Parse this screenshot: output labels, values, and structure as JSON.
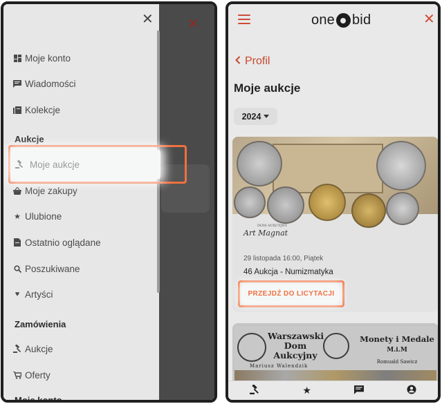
{
  "left_screen": {
    "drawer": {
      "items": [
        {
          "label": "Moje konto",
          "icon": "dashboard-icon"
        },
        {
          "label": "Wiadomości",
          "icon": "message-icon"
        },
        {
          "label": "Kolekcje",
          "icon": "collection-icon"
        }
      ],
      "section_aukcje": "Aukcje",
      "aukcje_items": [
        {
          "label": "Moje aukcje",
          "icon": "gavel-icon",
          "active": true
        },
        {
          "label": "Moje zakupy",
          "icon": "basket-icon"
        },
        {
          "label": "Ulubione",
          "icon": "star-icon"
        },
        {
          "label": "Ostatnio oglądane",
          "icon": "document-icon"
        },
        {
          "label": "Poszukiwane",
          "icon": "search-icon"
        },
        {
          "label": "Artyści",
          "icon": "heart-icon"
        }
      ],
      "section_zamowienia": "Zamówienia",
      "zamowienia_items": [
        {
          "label": "Aukcje",
          "icon": "gavel-icon"
        },
        {
          "label": "Oferty",
          "icon": "cart-icon"
        }
      ],
      "section_moje_konto": "Moje konto"
    }
  },
  "right_screen": {
    "header": {
      "logo_left": "one",
      "logo_right": "bid"
    },
    "back_label": "Profil",
    "page_title": "Moje aukcje",
    "year_filter": "2024",
    "auction_card": {
      "seller_small": "DOM AUKCYJNY",
      "seller_name": "Art Magnat",
      "date": "29 listopada 16:00, Piątek",
      "name": "46 Aukcja - Numizmatyka",
      "cta": "PRZEJDŹ DO LICYTACJI"
    },
    "second_card": {
      "left_title": "Warszawski Dom Aukcyjny",
      "left_sub": "Mariusz Walendzik",
      "right_title": "Monety i Medale",
      "right_mid": "M.i.M",
      "right_sub": "Romuald Sawicz"
    },
    "bottom_nav": [
      "gavel-icon",
      "star-icon",
      "chat-icon",
      "user-icon"
    ]
  },
  "colors": {
    "accent": "#d04a38",
    "highlight": "#f07040"
  }
}
